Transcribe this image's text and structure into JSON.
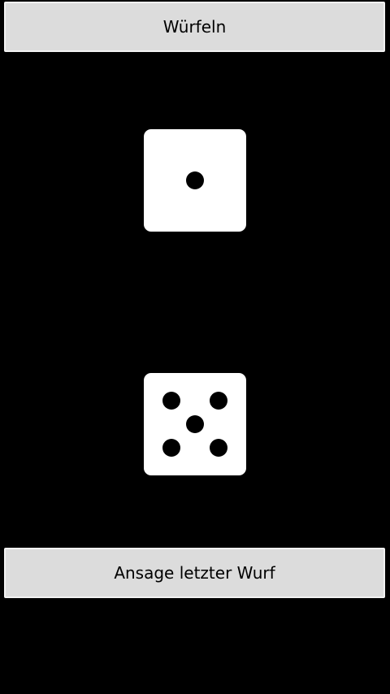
{
  "app": {
    "roll_button_label": "Würfeln",
    "announce_button_label": "Ansage letzter Wurf"
  },
  "dice": [
    {
      "value": 1
    },
    {
      "value": 5
    }
  ]
}
